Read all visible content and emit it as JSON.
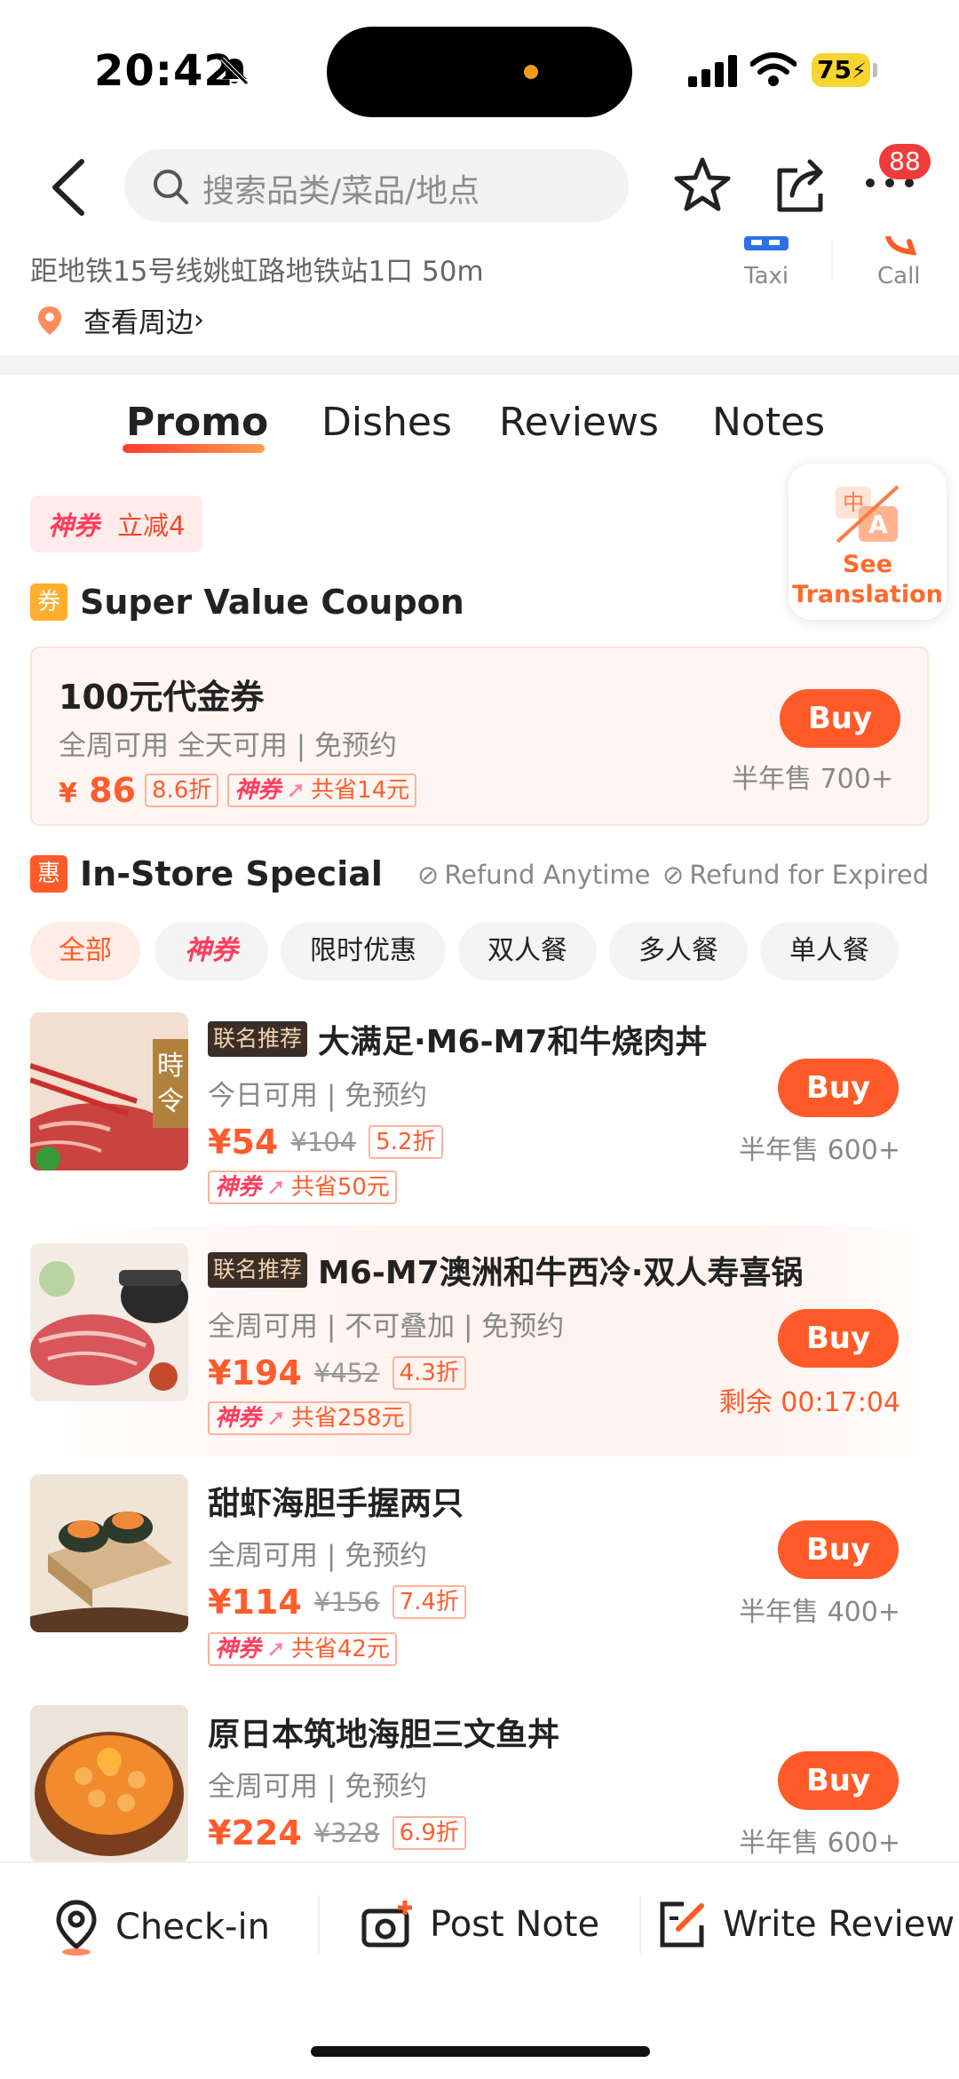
{
  "status": {
    "time": "20:42",
    "battery": "75"
  },
  "nav": {
    "search_placeholder": "搜索品类/菜品/地点",
    "badge": "88"
  },
  "address": {
    "text": "距地铁15号线姚虹路地铁站1口 50m",
    "nearby": "查看周边 ",
    "taxi": "Taxi",
    "call": "Call"
  },
  "tabs": [
    {
      "label": "Promo"
    },
    {
      "label": "Dishes"
    },
    {
      "label": "Reviews"
    },
    {
      "label": "Notes"
    }
  ],
  "translate": {
    "line1": "See",
    "line2": "Translation"
  },
  "promo_tag": {
    "brand": "神券",
    "text": "立减4"
  },
  "coupon_section": {
    "icon": "券",
    "title": "Super Value Coupon"
  },
  "coupon": {
    "title": "100元代金券",
    "sub": "全周可用 全天可用 | 免预约",
    "currency": "¥",
    "price": "86",
    "discount": "8.6折",
    "save_brand": "神券",
    "save_text": "共省14元",
    "buy": "Buy",
    "sold": "半年售 700+"
  },
  "instore": {
    "icon": "惠",
    "title": "In-Store Special",
    "refund1": "Refund Anytime",
    "refund2": "Refund for Expired"
  },
  "filters": [
    "全部",
    "神券",
    "限时优惠",
    "双人餐",
    "多人餐",
    "单人餐"
  ],
  "deals": [
    {
      "tag": "联名推荐",
      "title": "大满足·M6-M7和牛烧肉丼",
      "sub": "今日可用 | 免预约",
      "price": "¥54",
      "orig": "¥104",
      "discount": "5.2折",
      "save_brand": "神券",
      "save": "共省50元",
      "buy": "Buy",
      "sold": "半年售 600+"
    },
    {
      "tag": "联名推荐",
      "title": "M6-M7澳洲和牛西冷·双人寿喜锅",
      "sub": "全周可用 | 不可叠加 | 免预约",
      "price": "¥194",
      "orig": "¥452",
      "discount": "4.3折",
      "save_brand": "神券",
      "save": "共省258元",
      "buy": "Buy",
      "sold": "剩余 00:17:04"
    },
    {
      "tag": "",
      "title": "甜虾海胆手握两只",
      "sub": "全周可用 | 免预约",
      "price": "¥114",
      "orig": "¥156",
      "discount": "7.4折",
      "save_brand": "神券",
      "save": "共省42元",
      "buy": "Buy",
      "sold": "半年售 400+"
    },
    {
      "tag": "",
      "title": "原日本筑地海胆三文鱼丼",
      "sub": "全周可用 | 免预约",
      "price": "¥224",
      "orig": "¥328",
      "discount": "6.9折",
      "buy": "Buy",
      "sold": "半年售 600+"
    }
  ],
  "bottom": {
    "checkin": "Check-in",
    "post": "Post Note",
    "review": "Write Review"
  },
  "colors": {
    "accent": "#ff5a28",
    "brand_red": "#ff3d5f",
    "gold": "#f6d531"
  }
}
